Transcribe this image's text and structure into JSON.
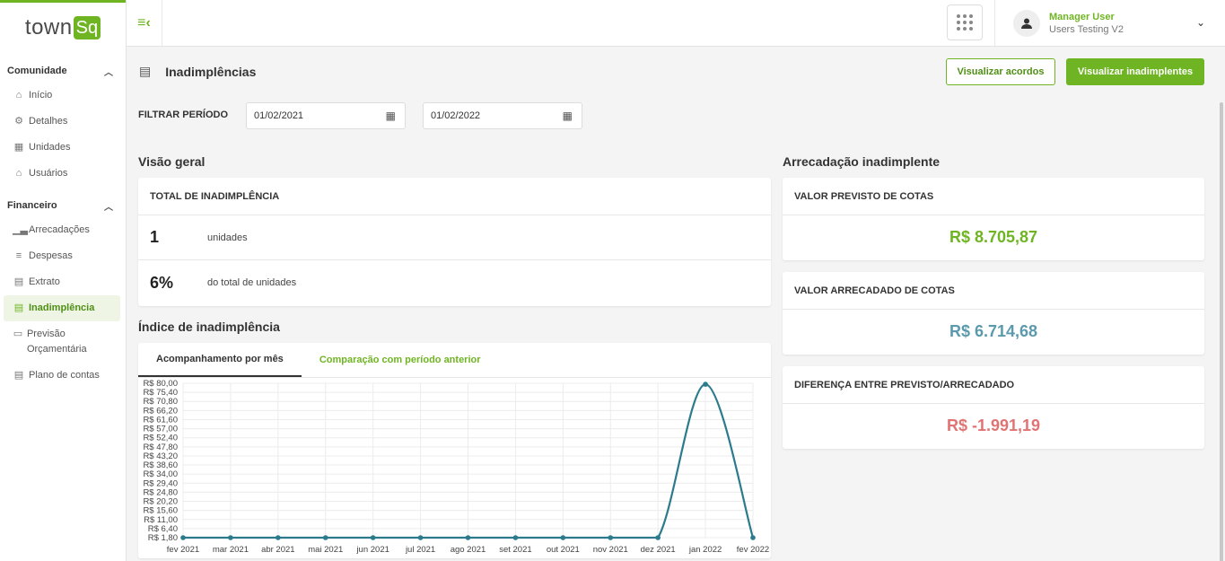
{
  "brand": {
    "logo_text": "town",
    "logo_badge": "Sq",
    "accent": "#6fb523"
  },
  "sidebar": {
    "sections": [
      {
        "title": "Comunidade",
        "items": [
          {
            "label": "Início",
            "icon": "home-icon"
          },
          {
            "label": "Detalhes",
            "icon": "details-icon"
          },
          {
            "label": "Unidades",
            "icon": "building-icon"
          },
          {
            "label": "Usuários",
            "icon": "users-icon"
          }
        ]
      },
      {
        "title": "Financeiro",
        "items": [
          {
            "label": "Arrecadações",
            "icon": "chart-icon"
          },
          {
            "label": "Despesas",
            "icon": "expenses-icon"
          },
          {
            "label": "Extrato",
            "icon": "statement-icon"
          },
          {
            "label": "Inadimplência",
            "icon": "default-icon",
            "active": true
          },
          {
            "label": "Previsão Orçamentária",
            "icon": "budget-icon"
          },
          {
            "label": "Plano de contas",
            "icon": "accounts-plan-icon"
          }
        ]
      }
    ]
  },
  "user": {
    "name": "Manager User",
    "org": "Users Testing V2"
  },
  "page": {
    "title": "Inadimplências",
    "btn_agreements": "Visualizar acordos",
    "btn_defaulters": "Visualizar inadimplentes",
    "filter_label": "FILTRAR PERÍODO",
    "date_start": "01/02/2021",
    "date_end": "01/02/2022"
  },
  "overview": {
    "title": "Visão geral",
    "card_title": "TOTAL DE INADIMPLÊNCIA",
    "units_value": "1",
    "units_label": "unidades",
    "pct_value": "6%",
    "pct_label": "do total de unidades"
  },
  "collection": {
    "title": "Arrecadação inadimplente",
    "expected_title": "VALOR PREVISTO DE COTAS",
    "expected_value": "R$ 8.705,87",
    "collected_title": "VALOR ARRECADADO DE COTAS",
    "collected_value": "R$ 6.714,68",
    "diff_title": "DIFERENÇA ENTRE PREVISTO/ARRECADADO",
    "diff_value": "R$ -1.991,19",
    "colors": {
      "expected": "#6fb523",
      "collected": "#5b9aad",
      "diff": "#e07474"
    }
  },
  "index": {
    "title": "Índice de inadimplência",
    "tab_monthly": "Acompanhamento por mês",
    "tab_compare": "Comparação com período anterior"
  },
  "chart_data": {
    "type": "line",
    "categories": [
      "fev 2021",
      "mar 2021",
      "abr 2021",
      "mai 2021",
      "jun 2021",
      "jul 2021",
      "ago 2021",
      "set 2021",
      "out 2021",
      "nov 2021",
      "dez 2021",
      "jan 2022",
      "fev 2022"
    ],
    "series": [
      {
        "values": [
          0,
          0,
          0,
          0,
          0,
          0,
          0,
          0,
          0,
          0,
          0,
          79.5,
          0
        ],
        "color": "#2b7b8c"
      }
    ],
    "y_ticks": [
      "R$ 80,00",
      "R$ 75,40",
      "R$ 70,80",
      "R$ 66,20",
      "R$ 61,60",
      "R$ 57,00",
      "R$ 52,40",
      "R$ 47,80",
      "R$ 43,20",
      "R$ 38,60",
      "R$ 34,00",
      "R$ 29,40",
      "R$ 24,80",
      "R$ 20,20",
      "R$ 15,60",
      "R$ 11,00",
      "R$ 6,40",
      "R$ 1,80"
    ],
    "ylim": [
      1.8,
      80
    ],
    "grid": true
  }
}
